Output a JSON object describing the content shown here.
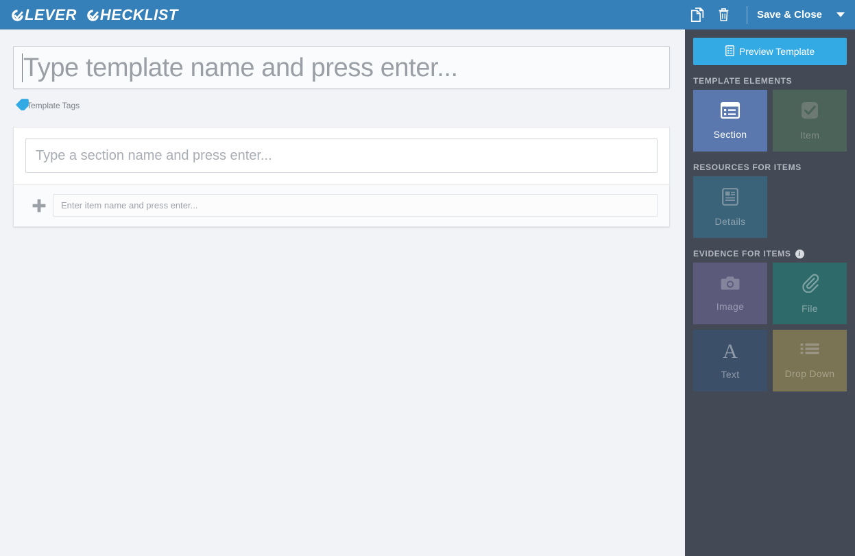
{
  "app": {
    "logo_word1": "LEVER",
    "logo_word2": "HECKLIST"
  },
  "topbar": {
    "copy_icon": "copy-icon",
    "delete_icon": "trash-icon",
    "save_close_label": "Save & Close",
    "dropdown_icon": "chevron-down-icon",
    "background_color": "#3580b8"
  },
  "main": {
    "template_name_placeholder": "Type template name and press enter...",
    "template_name_value": "",
    "tags_icon": "tag-icon",
    "tags_label": "Template Tags",
    "tags_icon_color": "#33aae4",
    "section_placeholder": "Type a section name and press enter...",
    "section_value": "",
    "add_item_icon": "plus-icon",
    "item_placeholder": "Enter item name and press enter...",
    "item_value": ""
  },
  "sidebar": {
    "preview_button": {
      "label": "Preview Template",
      "icon": "document-list-icon",
      "color": "#33aae4"
    },
    "groups": [
      {
        "title": "TEMPLATE ELEMENTS",
        "has_info": false,
        "tiles": [
          {
            "label": "Section",
            "icon": "list-box-icon",
            "color": "#5a78ad",
            "state": "enabled"
          },
          {
            "label": "Item",
            "icon": "checkbox-checked-icon",
            "color": "#4b6358",
            "state": "disabled"
          }
        ]
      },
      {
        "title": "RESOURCES FOR ITEMS",
        "has_info": false,
        "tiles": [
          {
            "label": "Details",
            "icon": "article-icon",
            "color": "#3a6379",
            "state": "disabled"
          }
        ]
      },
      {
        "title": "EVIDENCE FOR ITEMS",
        "has_info": true,
        "info_icon": "info-circle-icon",
        "tiles": [
          {
            "label": "Image",
            "icon": "camera-icon",
            "color": "#5b5a7b",
            "state": "disabled"
          },
          {
            "label": "File",
            "icon": "paperclip-icon",
            "color": "#2f6a6a",
            "state": "disabled"
          },
          {
            "label": "Text",
            "icon": "letter-a-icon",
            "color": "#3c4f68",
            "state": "disabled"
          },
          {
            "label": "Drop Down",
            "icon": "bullet-list-icon",
            "color": "#7a7354",
            "state": "disabled"
          }
        ]
      }
    ],
    "background_color": "#434a56"
  }
}
